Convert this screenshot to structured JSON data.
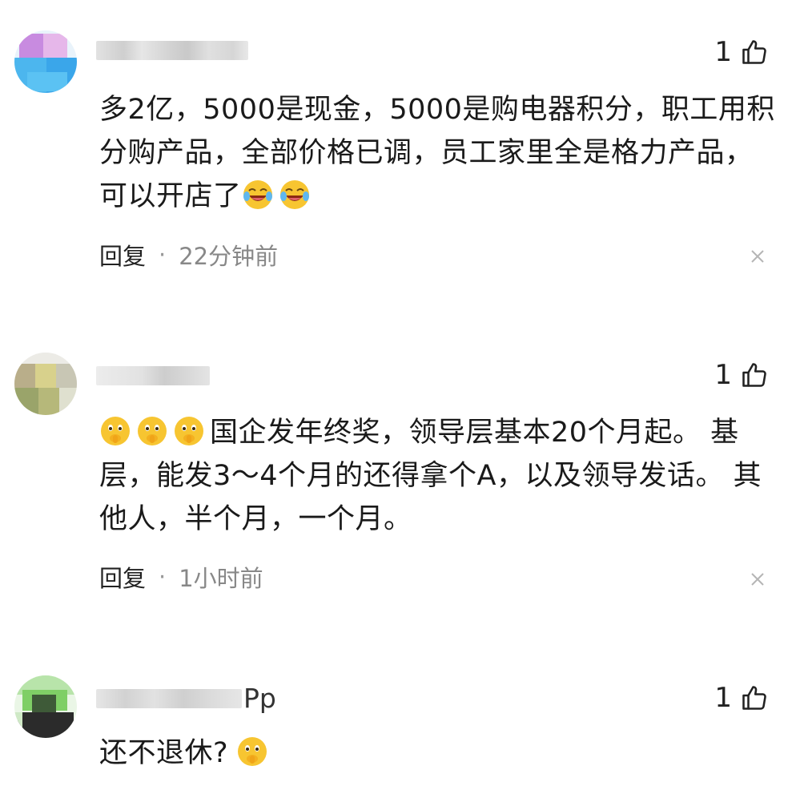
{
  "comments": [
    {
      "username_suffix": "",
      "like_count": "1",
      "text_before_emoji": "多2亿，5000是现金，5000是购电器积分，职工用积分购产品，全部价格已调，员工家里全是格力产品，可以开店了",
      "text_after_emoji": "",
      "emojis": [
        "laugh-cry-emoji",
        "laugh-cry-emoji"
      ],
      "reply_label": "回复",
      "separator": "·",
      "time": "22分钟前"
    },
    {
      "username_suffix": "",
      "like_count": "1",
      "text_before_emoji": "",
      "text_after_emoji": "国企发年终奖，领导层基本20个月起。 基层，能发3～4个月的还得拿个A，以及领导发话。 其他人，半个月，一个月。",
      "emojis": [
        "shush-emoji",
        "shush-emoji",
        "shush-emoji"
      ],
      "reply_label": "回复",
      "separator": "·",
      "time": "1小时前"
    },
    {
      "username_suffix": "Pp",
      "like_count": "1",
      "text_before_emoji": "还不退休?",
      "text_after_emoji": "",
      "emojis": [
        "shush-emoji"
      ],
      "reply_label": "",
      "separator": "",
      "time": ""
    }
  ],
  "icons": {
    "like": "thumbs-up-icon",
    "close": "close-icon"
  },
  "colors": {
    "text": "#1a1a1a",
    "meta": "#888888",
    "emoji_yellow": "#F7C531"
  }
}
